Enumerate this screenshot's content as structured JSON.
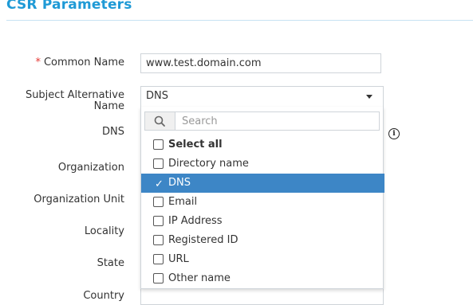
{
  "section": {
    "title": "CSR Parameters"
  },
  "fields": {
    "common_name": {
      "label": "Common Name",
      "required_mark": "*",
      "value": "www.test.domain.com"
    },
    "san": {
      "label_line1": "Subject Alternative",
      "label_line2": "Name",
      "value": "DNS"
    },
    "dns": {
      "label": "DNS"
    },
    "organization": {
      "label": "Organization"
    },
    "organization_unit": {
      "label": "Organization Unit"
    },
    "locality": {
      "label": "Locality"
    },
    "state": {
      "label": "State"
    },
    "country": {
      "label": "Country"
    }
  },
  "dropdown": {
    "search_placeholder": "Search",
    "options": [
      {
        "label": "Select all",
        "bold": true,
        "checked": false
      },
      {
        "label": "Directory name",
        "checked": false
      },
      {
        "label": "DNS",
        "checked": true
      },
      {
        "label": "Email",
        "checked": false
      },
      {
        "label": "IP Address",
        "checked": false
      },
      {
        "label": "Registered ID",
        "checked": false
      },
      {
        "label": "URL",
        "checked": false
      },
      {
        "label": "Other name",
        "checked": false
      }
    ]
  },
  "info_icon": {
    "glyph": "i"
  }
}
